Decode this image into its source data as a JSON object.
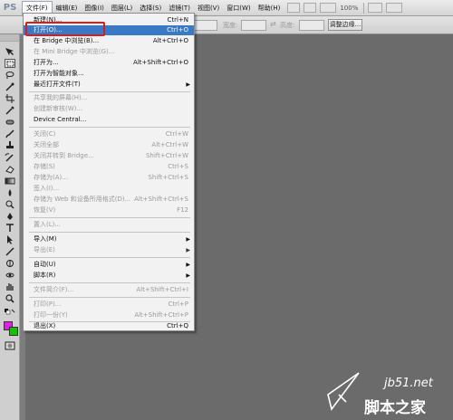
{
  "app": {
    "logo_text": "PS"
  },
  "menubar": {
    "items": [
      {
        "label": "文件(F)",
        "active": true
      },
      {
        "label": "编辑(E)"
      },
      {
        "label": "图像(I)"
      },
      {
        "label": "图层(L)"
      },
      {
        "label": "选择(S)"
      },
      {
        "label": "滤镜(T)"
      },
      {
        "label": "视图(V)"
      },
      {
        "label": "窗口(W)"
      },
      {
        "label": "帮助(H)"
      }
    ],
    "zoom_value": "100%"
  },
  "options_bar": {
    "width_label": "宽度:",
    "height_label": "高度:",
    "refine_edge_label": "调整边缘..."
  },
  "file_menu": {
    "items": [
      {
        "label": "新建(N)...",
        "shortcut": "Ctrl+N"
      },
      {
        "label": "打开(O)...",
        "shortcut": "Ctrl+O",
        "highlighted": true
      },
      {
        "label": "在 Bridge 中浏览(B)...",
        "shortcut": "Alt+Ctrl+O"
      },
      {
        "label": "在 Mini Bridge 中浏览(G)...",
        "shortcut": "",
        "disabled": true
      },
      {
        "label": "打开为...",
        "shortcut": "Alt+Shift+Ctrl+O"
      },
      {
        "label": "打开为智能对象...",
        "shortcut": ""
      },
      {
        "label": "最近打开文件(T)",
        "shortcut": "",
        "submenu": true
      },
      {
        "label": "共享我的屏幕(H)...",
        "shortcut": "",
        "disabled": true
      },
      {
        "label": "创建新审核(W)...",
        "shortcut": "",
        "disabled": true
      },
      {
        "label": "Device Central...",
        "shortcut": ""
      },
      {
        "label": "关闭(C)",
        "shortcut": "Ctrl+W",
        "disabled": true
      },
      {
        "label": "关闭全部",
        "shortcut": "Alt+Ctrl+W",
        "disabled": true
      },
      {
        "label": "关闭并转到 Bridge...",
        "shortcut": "Shift+Ctrl+W",
        "disabled": true
      },
      {
        "label": "存储(S)",
        "shortcut": "Ctrl+S",
        "disabled": true
      },
      {
        "label": "存储为(A)...",
        "shortcut": "Shift+Ctrl+S",
        "disabled": true
      },
      {
        "label": "签入(I)...",
        "shortcut": "",
        "disabled": true
      },
      {
        "label": "存储为 Web 和设备所用格式(D)...",
        "shortcut": "Alt+Shift+Ctrl+S",
        "disabled": true
      },
      {
        "label": "恢复(V)",
        "shortcut": "F12",
        "disabled": true
      },
      {
        "label": "置入(L)...",
        "shortcut": "",
        "disabled": true
      },
      {
        "label": "导入(M)",
        "shortcut": "",
        "submenu": true
      },
      {
        "label": "导出(E)",
        "shortcut": "",
        "submenu": true,
        "disabled": true
      },
      {
        "label": "自动(U)",
        "shortcut": "",
        "submenu": true
      },
      {
        "label": "脚本(R)",
        "shortcut": "",
        "submenu": true
      },
      {
        "label": "文件简介(F)...",
        "shortcut": "Alt+Shift+Ctrl+I",
        "disabled": true
      },
      {
        "label": "打印(P)...",
        "shortcut": "Ctrl+P",
        "disabled": true
      },
      {
        "label": "打印一份(Y)",
        "shortcut": "Alt+Shift+Ctrl+P",
        "disabled": true
      },
      {
        "label": "退出(X)",
        "shortcut": "Ctrl+Q"
      }
    ]
  },
  "colors": {
    "foreground": "#e81be8",
    "background": "#11c400",
    "highlight": "#3a78c8",
    "annotation_frame": "#d22020"
  },
  "watermark": {
    "site": "jb51.net",
    "brand": "脚本之家"
  }
}
